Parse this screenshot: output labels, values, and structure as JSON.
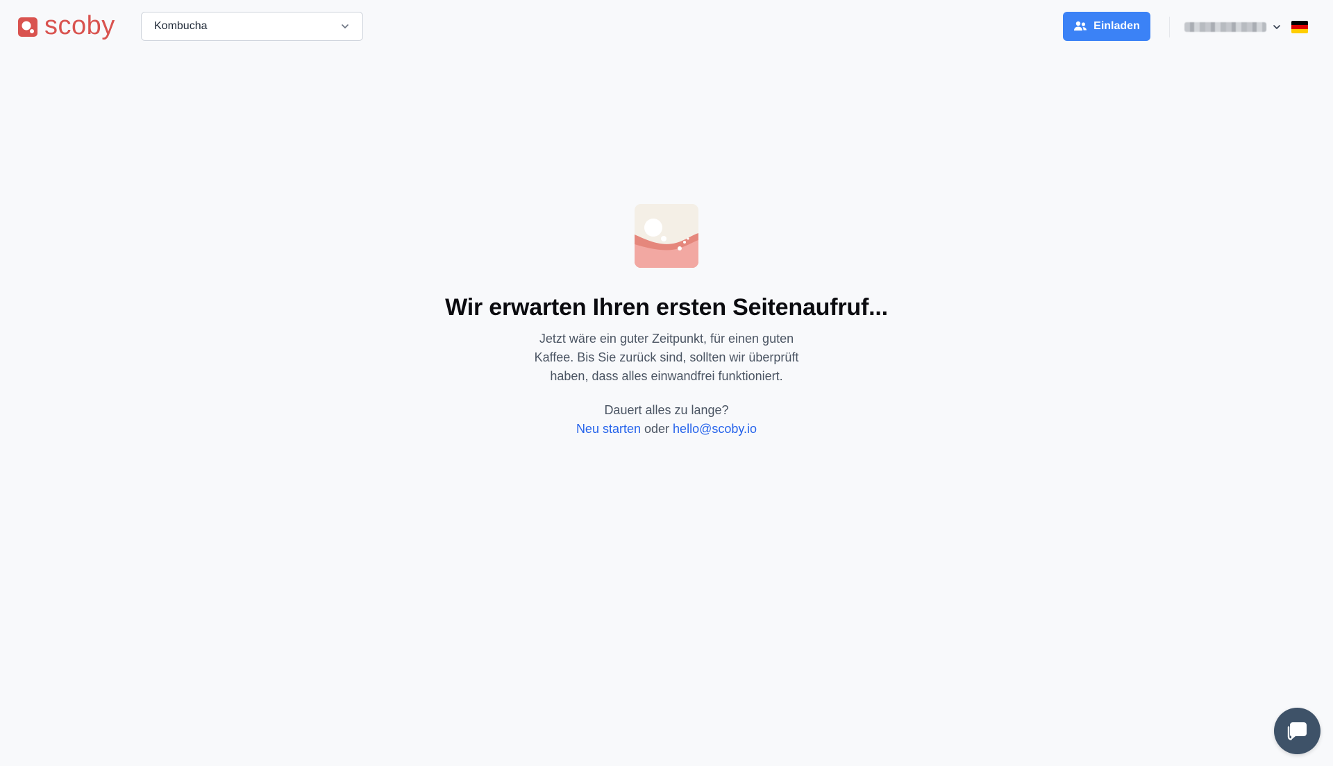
{
  "brand": {
    "name": "scoby",
    "color": "#d9534f"
  },
  "header": {
    "project_select": {
      "value": "Kombucha",
      "icon": "chevron-down-icon"
    },
    "invite_button": {
      "label": "Einladen",
      "icon": "users-icon",
      "color": "#3b82f6"
    },
    "account": {
      "name_obscured": true,
      "icon": "chevron-down-icon"
    },
    "language_flag": "de"
  },
  "empty_state": {
    "illustration": "waiting-illustration",
    "headline": "Wir erwarten Ihren ersten Seitenaufruf...",
    "description": "Jetzt wäre ein guter Zeitpunkt, für einen guten Kaffee. Bis Sie zurück sind, sollten wir überprüft haben, dass alles einwandfrei funktioniert.",
    "help_question": "Dauert alles zu lange?",
    "restart_link": "Neu starten",
    "or_text": "oder",
    "email_link": "hello@scoby.io",
    "link_color": "#2563eb"
  },
  "chat_widget": {
    "icon": "chat-icon",
    "color": "#3e5268"
  }
}
